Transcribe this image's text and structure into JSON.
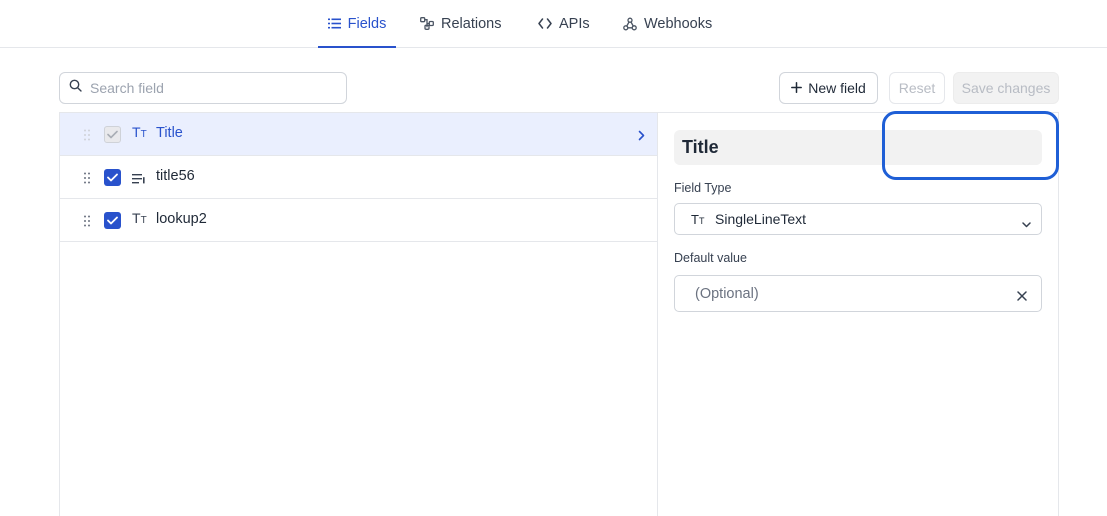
{
  "tabs": {
    "fields": "Fields",
    "relations": "Relations",
    "apis": "APIs",
    "webhooks": "Webhooks"
  },
  "toolbar": {
    "search_placeholder": "Search field",
    "new_field_label": "New field",
    "reset_label": "Reset",
    "save_label": "Save changes"
  },
  "fields": [
    {
      "name": "Title",
      "type_icon": "text-type-icon",
      "checked": true,
      "disabled": true,
      "selected": true
    },
    {
      "name": "title56",
      "type_icon": "long-text-icon",
      "checked": true,
      "disabled": false,
      "selected": false
    },
    {
      "name": "lookup2",
      "type_icon": "text-type-icon",
      "checked": true,
      "disabled": false,
      "selected": false
    }
  ],
  "detail": {
    "title": "Title",
    "field_type_label": "Field Type",
    "field_type_value": "SingleLineText",
    "default_value_label": "Default value",
    "default_value_placeholder": "(Optional)"
  },
  "colors": {
    "accent": "#2952cc",
    "selected_row": "#eaeffe",
    "highlight": "#1f5fd6"
  }
}
